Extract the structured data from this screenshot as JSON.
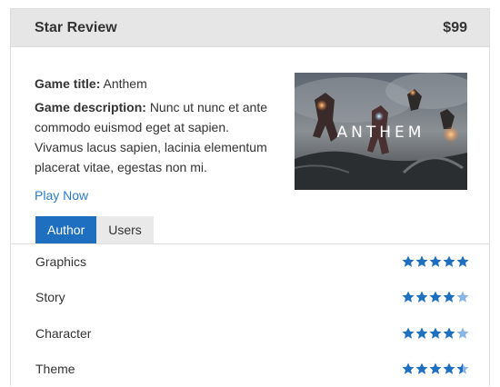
{
  "header": {
    "title": "Star Review",
    "price": "$99"
  },
  "game": {
    "title_label": "Game title:",
    "title_value": "Anthem",
    "description_label": "Game description:",
    "description_value": "Nunc ut nunc et ante commodo euismod eget at sapien. Vivamus lacus sapien, lacinia elementum placerat vitae, egestas non mi.",
    "play_link": "Play Now",
    "image_text": "ANTHEM"
  },
  "tabs": [
    {
      "label": "Author",
      "active": true
    },
    {
      "label": "Users",
      "active": false
    }
  ],
  "ratings": [
    {
      "label": "Graphics",
      "stars": 5
    },
    {
      "label": "Story",
      "stars": 4
    },
    {
      "label": "Character",
      "stars": 4
    },
    {
      "label": "Theme",
      "stars": 4.5
    }
  ],
  "colors": {
    "star_full": "#1f6fc0",
    "star_empty": "#8ab4e3",
    "accent": "#1f6fc0",
    "link": "#2b7bd0"
  }
}
